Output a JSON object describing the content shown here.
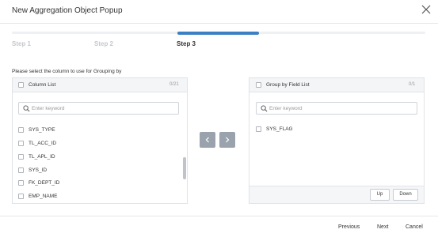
{
  "popup": {
    "title": "New Aggregation Object Popup"
  },
  "steps": [
    {
      "label": "Step 1",
      "active": false
    },
    {
      "label": "Step 2",
      "active": false
    },
    {
      "label": "Step 3",
      "active": true
    }
  ],
  "instruction": "Please select the column to use for Grouping by",
  "column_list": {
    "title": "Column List",
    "count": "0/21",
    "search_placeholder": "Enter keyword",
    "items": [
      "SYS_TYPE",
      "TL_ACC_ID",
      "TL_APL_ID",
      "SYS_ID",
      "FK_DEPT_ID",
      "EMP_NAME"
    ]
  },
  "group_list": {
    "title": "Group by Field List",
    "count": "0/1",
    "search_placeholder": "Enter keyword",
    "items": [
      "SYS_FLAG"
    ],
    "up_label": "Up",
    "down_label": "Down"
  },
  "transfer": {
    "left_icon": "chevron-left-icon",
    "right_icon": "chevron-right-icon"
  },
  "footer": {
    "previous_label": "Previous",
    "next_label": "Next",
    "cancel_label": "Cancel"
  },
  "colors": {
    "accent": "#3b7fc4",
    "arrow_button": "#9aa3ad",
    "inactive_step": "#c4c8cc"
  }
}
